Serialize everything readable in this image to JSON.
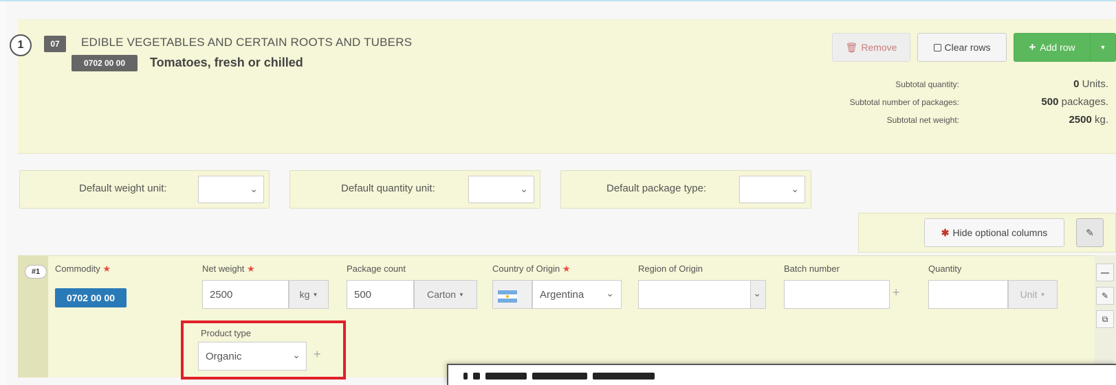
{
  "header": {
    "position_number": "1",
    "chapter_code": "07",
    "chapter_title": "EDIBLE VEGETABLES AND CERTAIN ROOTS AND TUBERS",
    "cn_code": "0702 00 00",
    "cn_title": "Tomatoes, fresh or chilled",
    "buttons": {
      "remove": "Remove",
      "clear_rows": "Clear rows",
      "add_row": "Add row"
    },
    "subtotals": [
      {
        "label": "Subtotal quantity:",
        "value": "0",
        "unit": "Units."
      },
      {
        "label": "Subtotal number of packages:",
        "value": "500",
        "unit": "packages."
      },
      {
        "label": "Subtotal net weight:",
        "value": "2500",
        "unit": "kg."
      }
    ]
  },
  "defaults": {
    "weight_unit_label": "Default weight unit:",
    "quantity_unit_label": "Default quantity unit:",
    "package_type_label": "Default package type:"
  },
  "optional": {
    "hide_label": "Hide optional columns"
  },
  "row": {
    "number": "#1",
    "commodity_label": "Commodity",
    "commodity_value": "0702 00 00",
    "net_weight_label": "Net weight",
    "net_weight_value": "2500",
    "net_weight_unit": "kg",
    "package_count_label": "Package count",
    "package_count_value": "500",
    "package_type": "Carton",
    "country_label": "Country of Origin",
    "country_value": "Argentina",
    "region_label": "Region of Origin",
    "batch_label": "Batch number",
    "quantity_label": "Quantity",
    "quantity_unit": "Unit",
    "product_type_label": "Product type",
    "product_type_value": "Organic"
  },
  "required_mark": "★",
  "colors": {
    "panel": "#f6f6d8",
    "add_button": "#5cb85c",
    "commodity_badge": "#2a7ab8",
    "highlight": "#e0202a"
  }
}
